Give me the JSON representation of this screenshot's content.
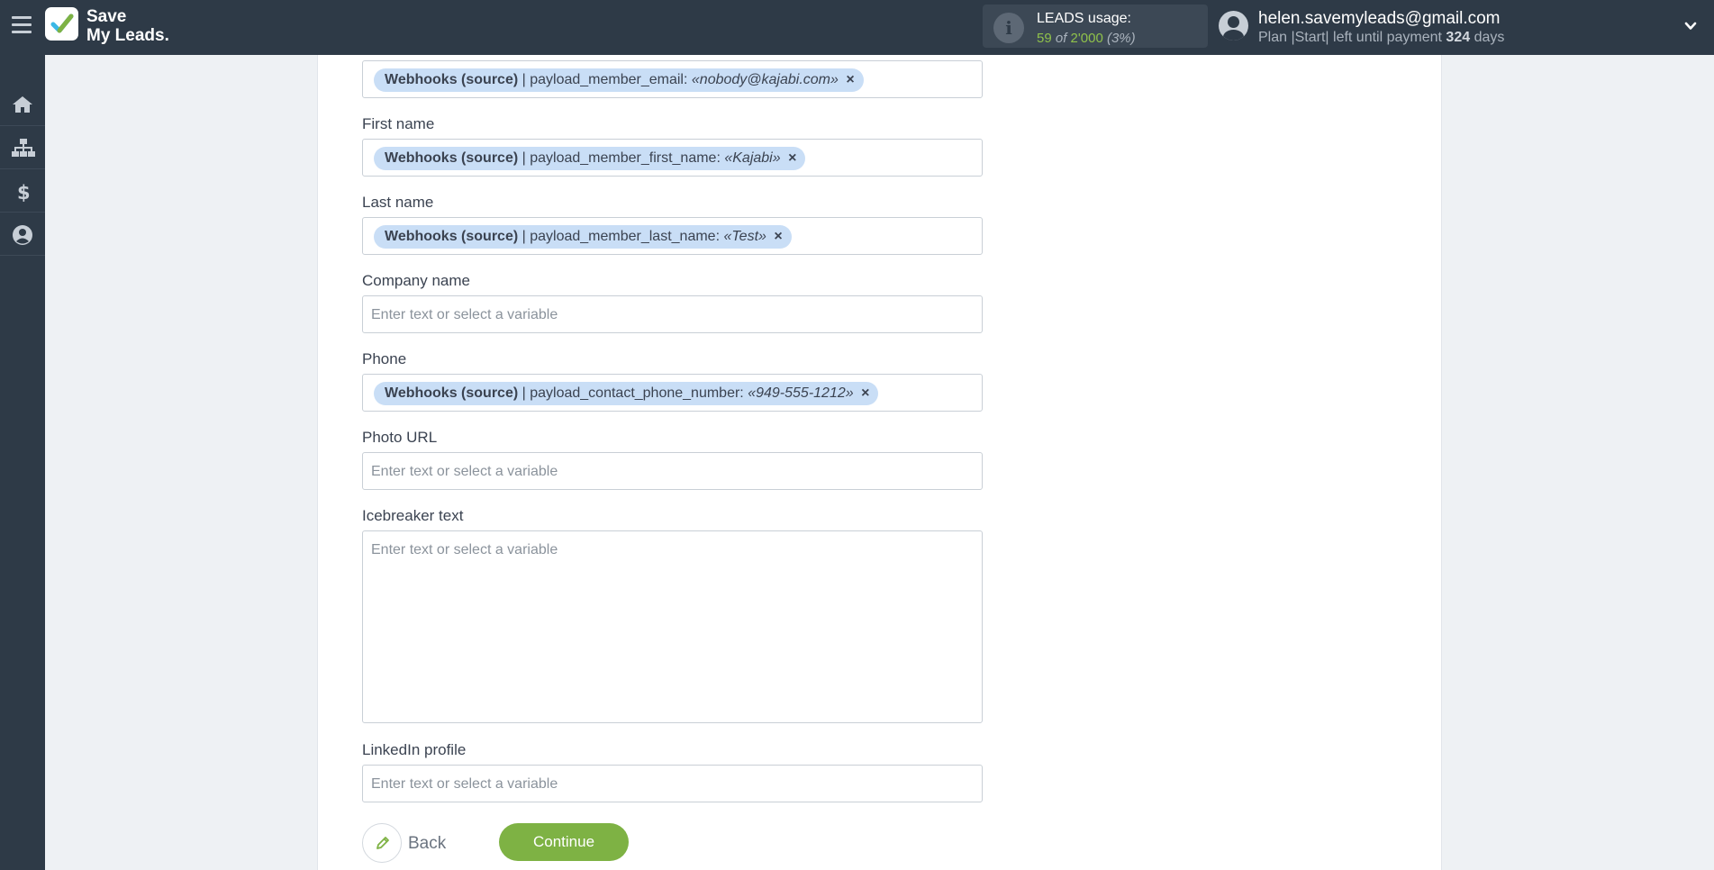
{
  "app": {
    "logo_line1": "Save",
    "logo_line2": "My Leads."
  },
  "usage": {
    "title": "LEADS usage:",
    "used": "59",
    "of_label": "of",
    "total": "2'000",
    "percent": "(3%)"
  },
  "user": {
    "email": "helen.savemyleads@gmail.com",
    "plan_text": "Plan |Start| left until payment",
    "days_count": "324",
    "days_label": "days"
  },
  "sidebar": {
    "items": [
      {
        "icon": "home-icon"
      },
      {
        "icon": "sitemap-icon"
      },
      {
        "icon": "dollar-icon"
      },
      {
        "icon": "user-icon"
      }
    ]
  },
  "form": {
    "email": {
      "tag_source": "Webhooks (source)",
      "tag_field": "| payload_member_email:",
      "tag_value": "«nobody@kajabi.com»",
      "tag_remove": "×"
    },
    "first_name": {
      "label": "First name",
      "tag_source": "Webhooks (source)",
      "tag_field": "| payload_member_first_name:",
      "tag_value": "«Kajabi»",
      "tag_remove": "×"
    },
    "last_name": {
      "label": "Last name",
      "tag_source": "Webhooks (source)",
      "tag_field": "| payload_member_last_name:",
      "tag_value": "«Test»",
      "tag_remove": "×"
    },
    "company_name": {
      "label": "Company name",
      "placeholder": "Enter text or select a variable"
    },
    "phone": {
      "label": "Phone",
      "tag_source": "Webhooks (source)",
      "tag_field": "| payload_contact_phone_number:",
      "tag_value": "«949-555-1212»",
      "tag_remove": "×"
    },
    "photo_url": {
      "label": "Photo URL",
      "placeholder": "Enter text or select a variable"
    },
    "icebreaker": {
      "label": "Icebreaker text",
      "placeholder": "Enter text or select a variable"
    },
    "linkedin": {
      "label": "LinkedIn profile",
      "placeholder": "Enter text or select a variable"
    }
  },
  "actions": {
    "back_label": "Back",
    "continue_label": "Continue"
  },
  "colors": {
    "topbar": "#2e3a47",
    "accent_green": "#7eb244",
    "tag_bg": "#c9def6"
  }
}
